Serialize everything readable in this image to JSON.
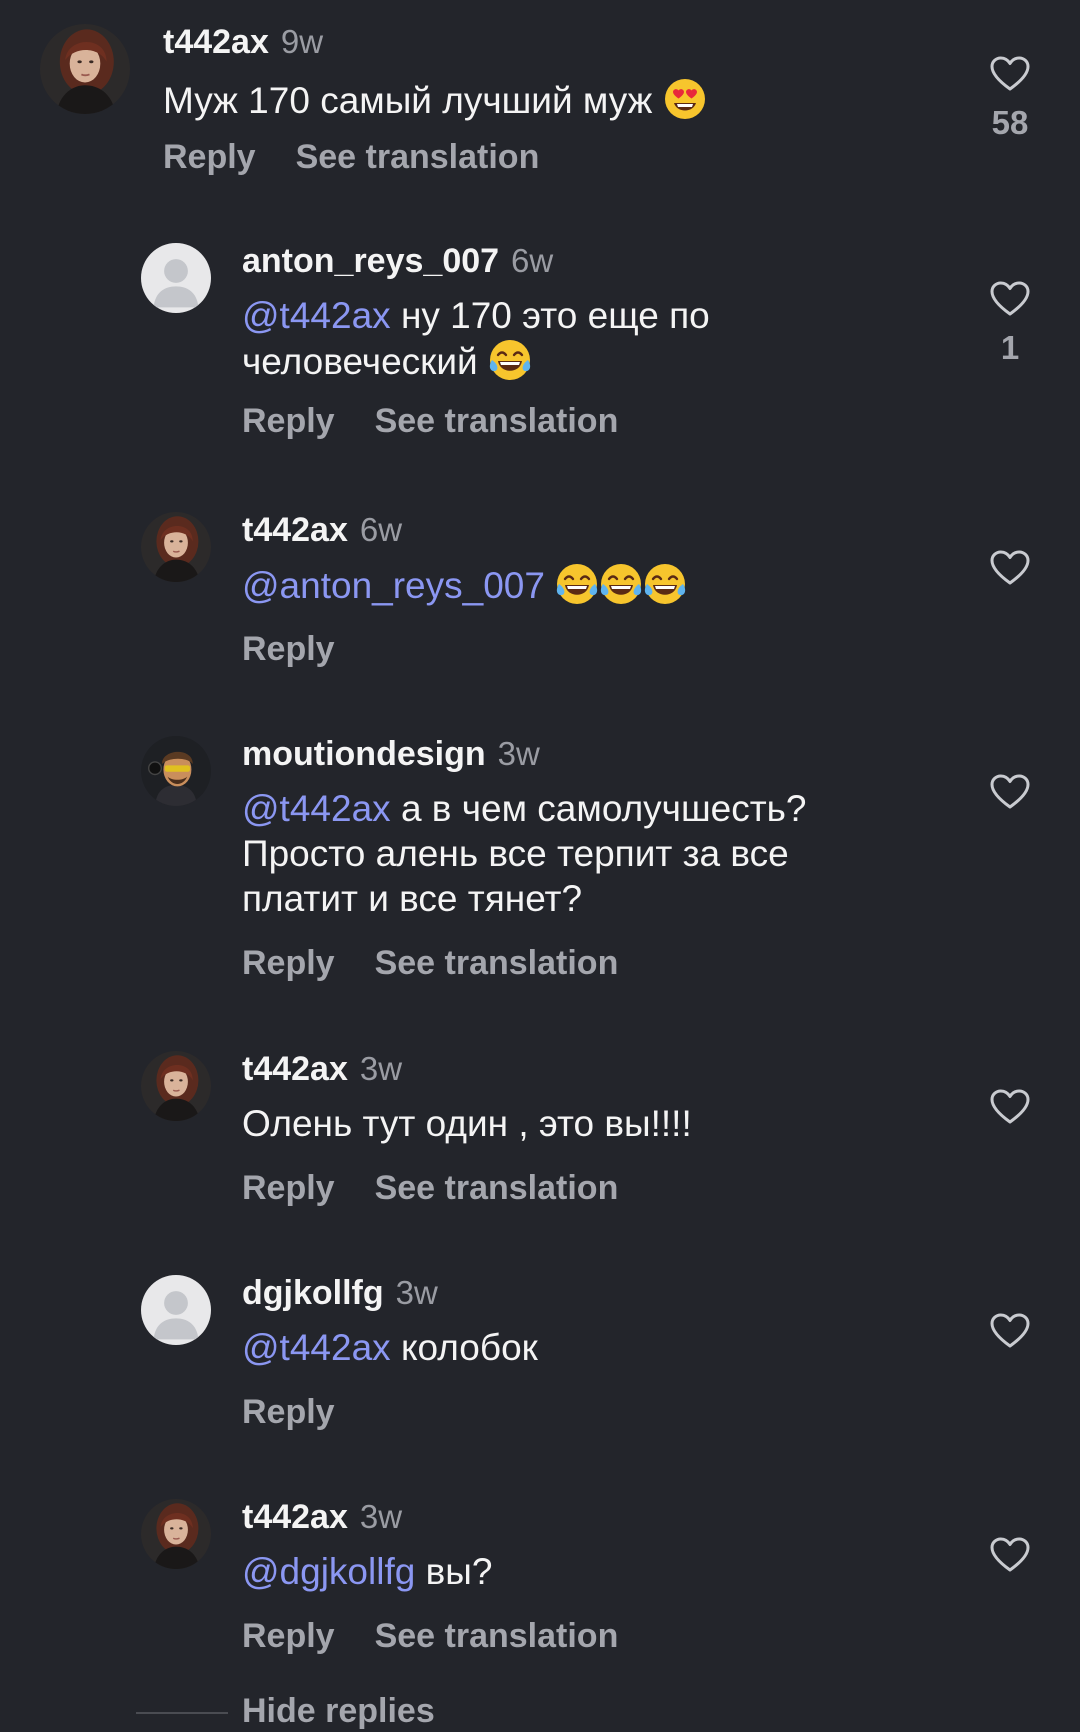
{
  "comments": [
    {
      "username": "t442ax",
      "time": "9w",
      "mention": "",
      "text": "Муж 170 самый лучший муж",
      "emoji": "heart-eyes-emoji",
      "reply_label": "Reply",
      "translate_label": "See translation",
      "likes": "58"
    },
    {
      "username": "anton_reys_007",
      "time": "6w",
      "mention": "@t442ax",
      "text": "ну 170 это еще по человеческий",
      "emoji": "tears-of-joy-emoji",
      "reply_label": "Reply",
      "translate_label": "See translation",
      "likes": "1"
    },
    {
      "username": "t442ax",
      "time": "6w",
      "mention": "@anton_reys_007",
      "text": "",
      "emoji": "tears-of-joy-emoji x3",
      "reply_label": "Reply",
      "translate_label": "",
      "likes": ""
    },
    {
      "username": "moutiondesign",
      "time": "3w",
      "mention": "@t442ax",
      "text": "а в чем самолучшесть? Просто алень все терпит за все платит и все тянет?",
      "emoji": "",
      "reply_label": "Reply",
      "translate_label": "See translation",
      "likes": ""
    },
    {
      "username": "t442ax",
      "time": "3w",
      "mention": "",
      "text": "Олень тут один , это вы!!!!",
      "emoji": "",
      "reply_label": "Reply",
      "translate_label": "See translation",
      "likes": ""
    },
    {
      "username": "dgjkollfg",
      "time": "3w",
      "mention": "@t442ax",
      "text": "колобок",
      "emoji": "",
      "reply_label": "Reply",
      "translate_label": "",
      "likes": ""
    },
    {
      "username": "t442ax",
      "time": "3w",
      "mention": "@dgjkollfg",
      "text": "вы?",
      "emoji": "",
      "reply_label": "Reply",
      "translate_label": "See translation",
      "likes": ""
    }
  ],
  "hide_replies_label": "Hide replies",
  "icons": {
    "like": "heart-outline-icon",
    "default_avatar": "person-silhouette-icon"
  },
  "colors": {
    "background": "#23252b",
    "mention": "#8b97f2",
    "muted": "#a4a6ad"
  }
}
